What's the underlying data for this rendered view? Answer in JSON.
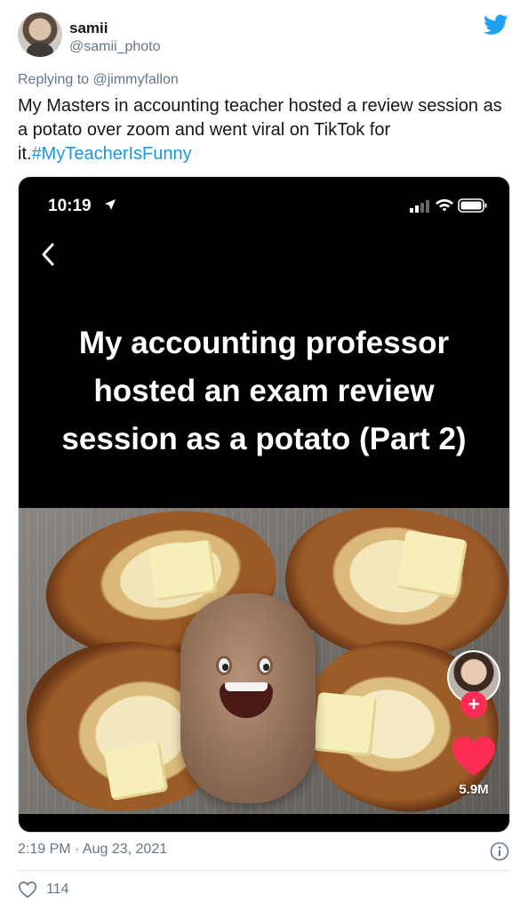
{
  "author": {
    "display_name": "samii",
    "handle": "@samii_photo"
  },
  "reply": {
    "prefix": "Replying to",
    "mention": "@jimmyfallon"
  },
  "tweet": {
    "text": "My Masters in accounting teacher hosted a review session as a potato over zoom and went viral on TikTok for it.",
    "hashtag": "#MyTeacherIsFunny"
  },
  "media": {
    "status_time": "10:19",
    "caption_lines": [
      "My accounting professor",
      "hosted an exam review",
      "session as a potato (Part 2)"
    ],
    "like_count": "5.9M",
    "follow_symbol": "+"
  },
  "footer": {
    "timestamp": "2:19 PM · Aug 23, 2021",
    "likes": "114"
  },
  "colors": {
    "brand": "#1da1f2",
    "hashtag": "#1b95e0",
    "muted": "#657786",
    "tiktok_red": "#fe2c55"
  },
  "icons": [
    "twitter-bird-icon",
    "location-arrow-icon",
    "signal-icon",
    "wifi-icon",
    "battery-icon",
    "back-chevron-icon",
    "heart-icon",
    "info-icon",
    "like-heart-outline-icon"
  ]
}
